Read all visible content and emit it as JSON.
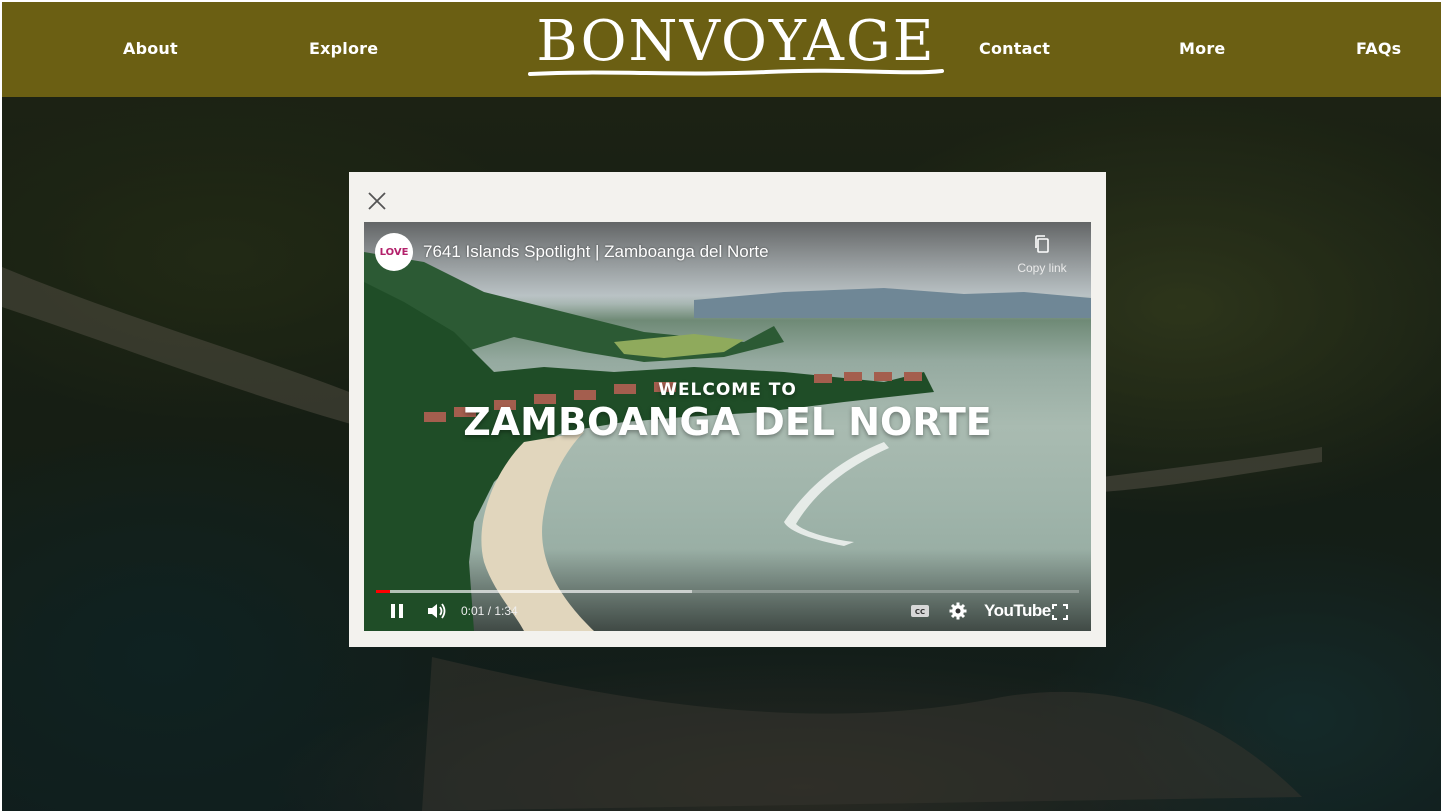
{
  "header": {
    "logo_text": "BONVOYAGE",
    "nav": {
      "about": "About",
      "explore": "Explore",
      "contact": "Contact",
      "more": "More",
      "faqs": "FAQs"
    },
    "background_color": "#6b5f13"
  },
  "modal": {
    "close_icon": "close-icon",
    "video": {
      "channel_avatar_text": "LOVE",
      "title": "7641 Islands Spotlight | Zamboanga del Norte",
      "copy_link_label": "Copy link",
      "overlay_small": "WELCOME TO",
      "overlay_big": "ZAMBOANGA DEL NORTE",
      "time": "0:01 / 1:34",
      "played_fraction": 0.02,
      "buffered_fraction": 0.45,
      "brand": "YouTube",
      "controls": [
        "pause-icon",
        "volume-icon",
        "captions-icon",
        "settings-icon",
        "fullscreen-icon"
      ]
    }
  }
}
